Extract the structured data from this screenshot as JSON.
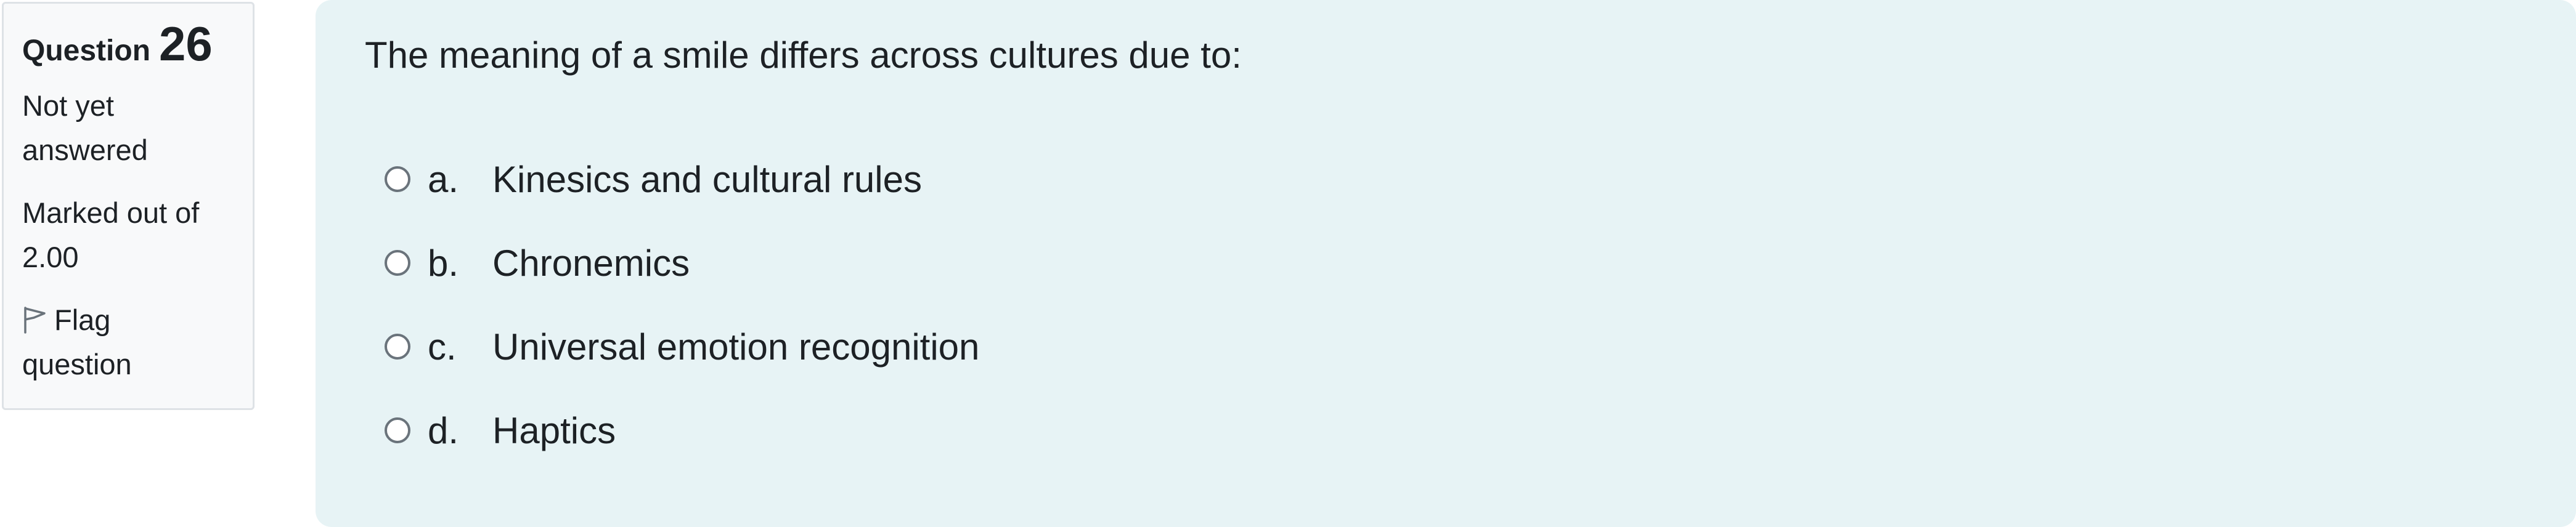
{
  "info": {
    "question_label": "Question",
    "question_number": "26",
    "state_line1": "Not yet",
    "state_line2": "answered",
    "grade_line1": "Marked out of",
    "grade_line2": "2.00",
    "flag_line1": "Flag",
    "flag_line2": "question",
    "flag_icon": "flag-outline-icon"
  },
  "question": {
    "text": "The meaning of a smile differs across cultures due to:",
    "answers": [
      {
        "letter": "a.",
        "text": "Kinesics and cultural rules",
        "selected": false
      },
      {
        "letter": "b.",
        "text": "Chronemics",
        "selected": false
      },
      {
        "letter": "c.",
        "text": "Universal emotion recognition",
        "selected": false
      },
      {
        "letter": "d.",
        "text": "Haptics",
        "selected": false
      }
    ]
  },
  "colors": {
    "info_bg": "#f8f9fa",
    "content_bg": "#e7f3f5",
    "text": "#1d2125"
  }
}
